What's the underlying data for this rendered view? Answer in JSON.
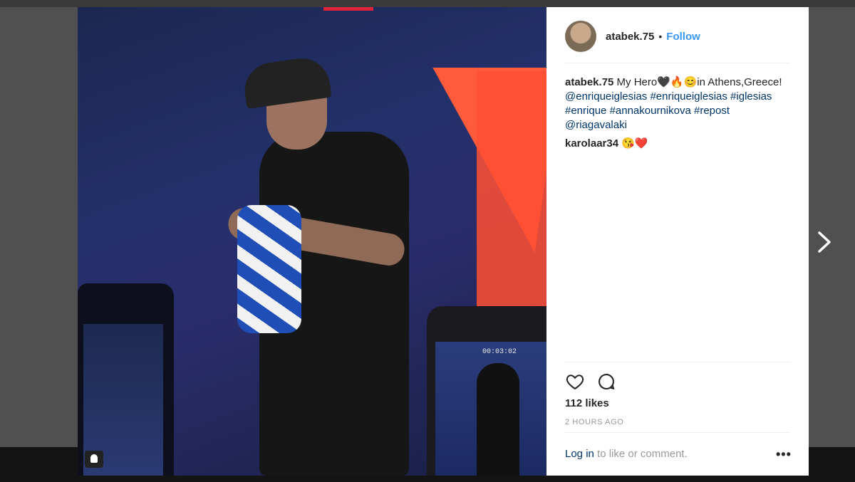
{
  "post": {
    "username": "atabek.75",
    "separator": "•",
    "follow_label": "Follow",
    "caption": {
      "author": "atabek.75",
      "text": " My Hero🖤🔥😊in Athens,Greece!",
      "tags": [
        "@enriqueiglesias",
        "#enriqueiglesias",
        "#iglesias",
        "#enrique",
        "#annakournikova",
        "#repost",
        "@riagavalaki"
      ]
    },
    "comment": {
      "author": "karolaar34",
      "text": "😘❤️"
    },
    "likes": "112 likes",
    "timestamp": "2 HOURS AGO",
    "login_link": "Log in",
    "login_text": " to like or comment.",
    "more_label": "•••",
    "video_timer": "00:03:02"
  },
  "colors": {
    "link": "#3897f0",
    "hashtag": "#003569",
    "text": "#262626",
    "muted": "#999999"
  },
  "icons": [
    "heart-icon",
    "comment-icon",
    "more-options-icon",
    "next-arrow-icon",
    "user-tag-icon"
  ]
}
